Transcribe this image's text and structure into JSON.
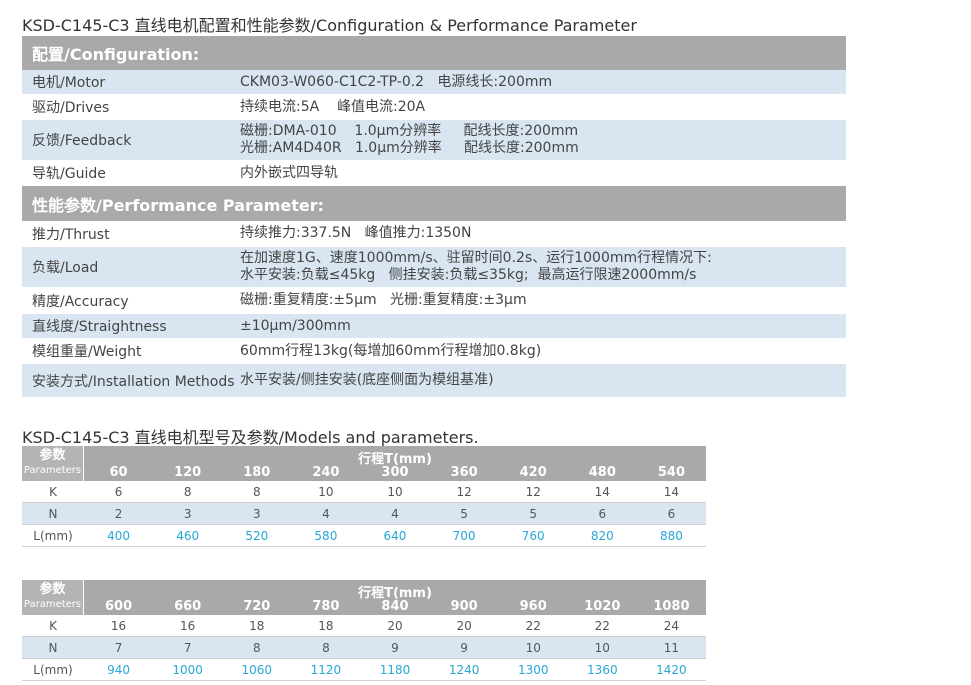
{
  "title1": "KSD-C145-C3 直线电机配置和性能参数/Configuration & Performance Parameter",
  "config": {
    "header": "配置/Configuration:",
    "rows": [
      {
        "k": "电机/Motor",
        "v": [
          "CKM03-W060-C1C2-TP-0.2   电源线长:200mm"
        ]
      },
      {
        "k": "驱动/Drives",
        "v": [
          "持续电流:5A    峰值电流:20A"
        ]
      },
      {
        "k": "反馈/Feedback",
        "v": [
          "磁栅:DMA-010    1.0μm分辨率     配线长度:200mm",
          "光栅:AM4D40R   1.0μm分辨率     配线长度:200mm"
        ]
      },
      {
        "k": "导轨/Guide",
        "v": [
          "内外嵌式四导轨"
        ]
      }
    ]
  },
  "performance": {
    "header": "性能参数/Performance Parameter:",
    "rows": [
      {
        "k": "推力/Thrust",
        "v": [
          "持续推力:337.5N   峰值推力:1350N"
        ]
      },
      {
        "k": "负载/Load",
        "v": [
          "在加速度1G、速度1000mm/s、驻留时间0.2s、运行1000mm行程情况下:",
          "水平安装:负载≤45kg   侧挂安装:负载≤35kg;  最高运行限速2000mm/s"
        ]
      },
      {
        "k": "精度/Accuracy",
        "v": [
          "磁栅:重复精度:±5μm   光栅:重复精度:±3μm"
        ]
      },
      {
        "k": "直线度/Straightness",
        "v": [
          "±10μm/300mm"
        ]
      },
      {
        "k": "模组重量/Weight",
        "v": [
          "60mm行程13kg(每增加60mm行程增加0.8kg)"
        ]
      },
      {
        "k": "安装方式/Installation Methods",
        "v": [
          "水平安装/侧挂安装(底座侧面为模组基准)"
        ]
      }
    ]
  },
  "title2": "KSD-C145-C3 直线电机型号及参数/Models and parameters.",
  "models": {
    "param_zh": "参数",
    "param_en": "Parameters",
    "travel_label": "行程T(mm)",
    "tables": [
      {
        "travel": [
          "60",
          "120",
          "180",
          "240",
          "300",
          "360",
          "420",
          "480",
          "540"
        ],
        "rows": [
          {
            "k": "K",
            "vals": [
              "6",
              "8",
              "8",
              "10",
              "10",
              "12",
              "12",
              "14",
              "14"
            ]
          },
          {
            "k": "N",
            "vals": [
              "2",
              "3",
              "3",
              "4",
              "4",
              "5",
              "5",
              "6",
              "6"
            ]
          },
          {
            "k": "L(mm)",
            "vals": [
              "400",
              "460",
              "520",
              "580",
              "640",
              "700",
              "760",
              "820",
              "880"
            ]
          }
        ]
      },
      {
        "travel": [
          "600",
          "660",
          "720",
          "780",
          "840",
          "900",
          "960",
          "1020",
          "1080"
        ],
        "rows": [
          {
            "k": "K",
            "vals": [
              "16",
              "16",
              "18",
              "18",
              "20",
              "20",
              "22",
              "22",
              "24"
            ]
          },
          {
            "k": "N",
            "vals": [
              "7",
              "7",
              "8",
              "8",
              "9",
              "9",
              "10",
              "10",
              "11"
            ]
          },
          {
            "k": "L(mm)",
            "vals": [
              "940",
              "1000",
              "1060",
              "1120",
              "1180",
              "1240",
              "1300",
              "1360",
              "1420"
            ]
          }
        ]
      }
    ]
  },
  "colors": {
    "header_gray": "#a9a9a9",
    "row_blue": "#d9e6f2",
    "length_text": "#27a8d6"
  }
}
